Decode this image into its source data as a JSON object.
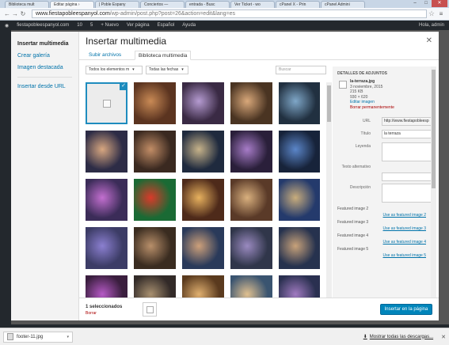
{
  "browser": {
    "tabs": [
      {
        "label": "Biblioteca mult"
      },
      {
        "label": "Editar página ›"
      },
      {
        "label": "| Poble Espany"
      },
      {
        "label": "Conciertos — "
      },
      {
        "label": "entrada - Busc"
      },
      {
        "label": "Ver Ticket - wo"
      },
      {
        "label": "cPanel X - Prin"
      },
      {
        "label": "cPanel Admini"
      }
    ],
    "url_host": "www.fiestapobleespanyol.com",
    "url_path": "/wp-admin/post.php?post=26&action=edit&lang=es"
  },
  "adminbar": {
    "site": "fiestapobleespanyol.com",
    "updates": "10",
    "comments": "5",
    "new": "+ Nuevo",
    "view": "Ver página",
    "lang": "Español",
    "help": "Ayuda",
    "greeting": "Hola, admin"
  },
  "modal": {
    "title": "Insertar multimedia",
    "sidebar": [
      {
        "label": "Insertar multimedia",
        "current": true
      },
      {
        "label": "Crear galería"
      },
      {
        "label": "Imagen destacada"
      },
      {
        "label": "Insertar desde URL"
      }
    ],
    "tabs": [
      {
        "label": "Subir archivos"
      },
      {
        "label": "Biblioteca multimedia",
        "active": true
      }
    ],
    "filter_type": "Todos los elementos m",
    "filter_date": "Todas las fechas",
    "search_placeholder": "Buscar"
  },
  "thumbnails": [
    {
      "bg": "#ececec",
      "broken": true,
      "selected": true
    },
    {
      "bg": "#5b3420",
      "c2": "#c98a55"
    },
    {
      "bg": "#3a2a44",
      "c2": "#b59bd1"
    },
    {
      "bg": "#4a3422",
      "c2": "#d9a87a"
    },
    {
      "bg": "#213040",
      "c2": "#7fa7c8"
    },
    {
      "bg": "#2d2c46",
      "c2": "#d8a780"
    },
    {
      "bg": "#3a2920",
      "c2": "#c28d66"
    },
    {
      "bg": "#1f2a3e",
      "c2": "#c7b38a"
    },
    {
      "bg": "#2a1f3a",
      "c2": "#a77cc8"
    },
    {
      "bg": "#17233a",
      "c2": "#5b86c9"
    },
    {
      "bg": "#3b2c58",
      "c2": "#c36fd0"
    },
    {
      "bg": "#1a6a34",
      "c2": "#d93a2a"
    },
    {
      "bg": "#4e2a1a",
      "c2": "#e7b15e"
    },
    {
      "bg": "#5a3a28",
      "c2": "#d9b07e"
    },
    {
      "bg": "#243a6c",
      "c2": "#c9ad7c"
    },
    {
      "bg": "#3c3c66",
      "c2": "#8b7fd0"
    },
    {
      "bg": "#3a2c20",
      "c2": "#b88f6a"
    },
    {
      "bg": "#2a3a5a",
      "c2": "#cda07a"
    },
    {
      "bg": "#30364a",
      "c2": "#9a8ac0"
    },
    {
      "bg": "#26324e",
      "c2": "#c8a27a"
    },
    {
      "bg": "#3a1e3e",
      "c2": "#b65ac6"
    },
    {
      "bg": "#322a28",
      "c2": "#a89070"
    },
    {
      "bg": "#5a3a1e",
      "c2": "#e0b070"
    },
    {
      "bg": "#3a5470",
      "c2": "#e0c090"
    },
    {
      "bg": "#2a3050",
      "c2": "#a07ac0"
    }
  ],
  "details": {
    "heading": "DETALLES DE ADJUNTOS",
    "filename": "la-terraza.jpg",
    "date": "3 noviembre, 2015",
    "size": "215 KB",
    "dimensions": "930 × 620",
    "edit": "Editar imagen",
    "delete": "Borrar permanentemente",
    "fields": [
      {
        "label": "URL",
        "value": "http://www.fiestapobleesp",
        "kind": "readonly"
      },
      {
        "label": "Título",
        "value": "la terraza",
        "kind": "text"
      },
      {
        "label": "Leyenda",
        "value": "",
        "kind": "area"
      },
      {
        "label": "Texto alternativo",
        "value": "",
        "kind": "text2"
      },
      {
        "label": "Descripción",
        "value": "",
        "kind": "area"
      }
    ],
    "featured": [
      {
        "label": "Featured image 2",
        "link": "Use as featured image 2"
      },
      {
        "label": "Featured image 3",
        "link": "Use as featured image 3"
      },
      {
        "label": "Featured image 4",
        "link": "Use as featured image 4"
      },
      {
        "label": "Featured image 5",
        "link": "Use as featured image 5"
      }
    ]
  },
  "footer": {
    "count": "1 seleccionados",
    "clear": "Borrar",
    "insert": "Insertar en la página"
  },
  "download": {
    "file": "footer-11.jpg",
    "show_all": "Mostrar todas las descargas..."
  }
}
